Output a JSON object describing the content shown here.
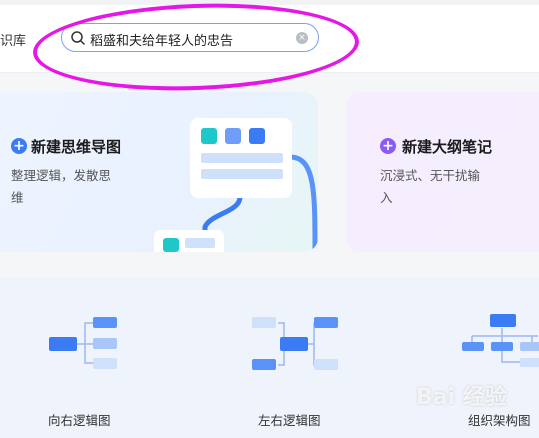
{
  "header": {
    "library_label": "识库",
    "search": {
      "value": "稻盛和夫给年轻人的忠告"
    }
  },
  "cards": {
    "mindmap": {
      "title": "新建思维导图",
      "desc_line1": "整理逻辑，发散思",
      "desc_line2": "维"
    },
    "outline": {
      "title": "新建大纲笔记",
      "desc_line1": "沉浸式、无干扰输",
      "desc_line2": "入"
    }
  },
  "templates": [
    {
      "label": "向右逻辑图"
    },
    {
      "label": "左右逻辑图"
    },
    {
      "label": "组织架构图"
    }
  ],
  "watermark": "Bai  经验",
  "colors": {
    "accent": "#3b7cf5",
    "purple_accent": "#8a5cf5",
    "highlight": "#e616e6"
  }
}
